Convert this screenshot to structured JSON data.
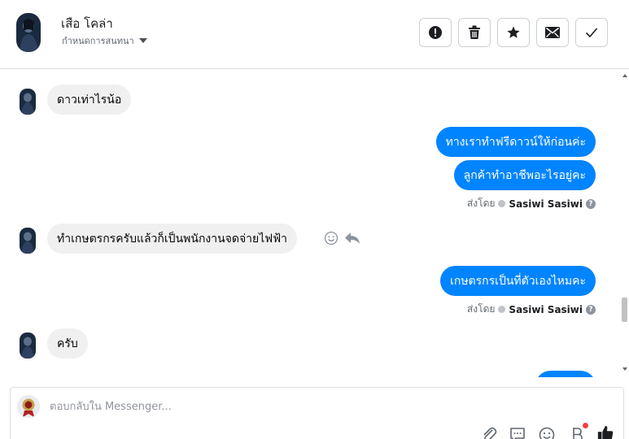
{
  "header": {
    "name": "เสือ โคล่า",
    "subtitle": "กำหนดการสนทนา",
    "buttons": [
      {
        "icon": "exclamation-icon"
      },
      {
        "icon": "trash-icon"
      },
      {
        "icon": "star-icon"
      },
      {
        "icon": "mail-icon"
      },
      {
        "icon": "checkmark-icon"
      }
    ]
  },
  "messages": {
    "in_1": "ดาวเท่าไรน้อ",
    "out_1": "ทางเราทำฟรีดาวน์ให้ก่อนค่ะ",
    "out_2": "ลูกค้าทำอาชีพอะไรอยู่คะ",
    "sent_by_label": "ส่งโดย",
    "sender_1": "Sasiwi Sasiwi",
    "in_2": "ทำเกษตรกรครับแล้วก็เป็นพนักงานจดจ่ายไฟฟ้า",
    "out_3": "เกษตรกรเป็นที่ตัวเองไหมคะ",
    "sender_2": "Sasiwi Sasiwi",
    "in_3": "ครับ"
  },
  "composer": {
    "placeholder": "ตอบกลับใน Messenger..."
  },
  "colors": {
    "outgoing_bubble": "#0084ff",
    "incoming_bubble": "#f0f0f0",
    "notification": "#fa3e3e"
  }
}
